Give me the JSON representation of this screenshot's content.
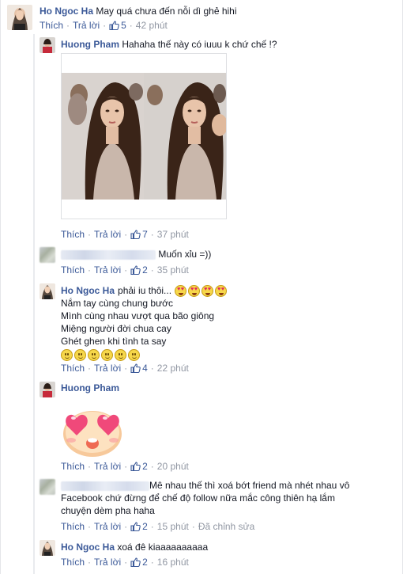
{
  "comments": [
    {
      "author": "Ho Ngoc Ha",
      "text": "May quá chưa đến nỗi dì ghẻ hihi",
      "actions": {
        "like": "Thích",
        "reply": "Trả lời",
        "likes": "5",
        "time": "42 phút"
      }
    },
    {
      "author": "Huong Pham",
      "text": "Hahaha thế này có iuuu k chứ chế !?",
      "actions": {
        "like": "Thích",
        "reply": "Trả lời",
        "likes": "7",
        "time": "37 phút"
      }
    },
    {
      "author": "",
      "text": "Muốn xỉu =))",
      "actions": {
        "like": "Thích",
        "reply": "Trả lời",
        "likes": "2",
        "time": "35 phút"
      }
    },
    {
      "author": "Ho Ngoc Ha",
      "text": "phải iu thôi...",
      "lines": [
        "Nắm tay cùng chung bước",
        "Mình cùng nhau vượt qua bão giông",
        "Miệng người đời chua cay",
        "Ghét ghen khi tình ta say"
      ],
      "actions": {
        "like": "Thích",
        "reply": "Trả lời",
        "likes": "4",
        "time": "22 phút"
      }
    },
    {
      "author": "Huong Pham",
      "sticker": "heart-eyes-emoji",
      "actions": {
        "like": "Thích",
        "reply": "Trả lời",
        "likes": "2",
        "time": "20 phút"
      }
    },
    {
      "author": "",
      "text_lines": [
        "Mê nhau thế thì xoá bớt friend mà nhét nhau vô",
        "Facebook chứ đừng để chế độ follow nữa mắc công thiên hạ lắm",
        "chuyện dèm pha haha"
      ],
      "actions": {
        "like": "Thích",
        "reply": "Trả lời",
        "likes": "2",
        "time": "15 phút",
        "edited": "Đã chỉnh sửa"
      }
    },
    {
      "author": "Ho Ngoc Ha",
      "text": "xoá đê kiaaaaaaaaaa",
      "actions": {
        "like": "Thích",
        "reply": "Trả lời",
        "likes": "2",
        "time": "16 phút"
      }
    }
  ],
  "colors": {
    "link": "#3b5998",
    "meta": "#9197a3",
    "text": "#141823",
    "border": "#dddfe2"
  }
}
